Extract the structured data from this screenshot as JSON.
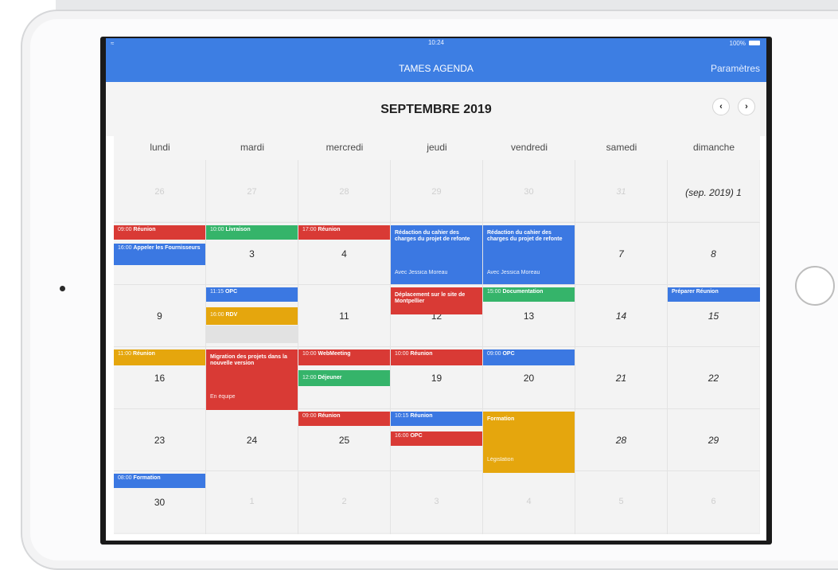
{
  "status": {
    "time": "10:24",
    "battery": "100%"
  },
  "header": {
    "title": "TAMES AGENDA",
    "settings": "Paramètres"
  },
  "calendar": {
    "month_title": "SEPTEMBRE 2019",
    "prev": "‹",
    "next": "›",
    "weekdays": [
      "lundi",
      "mardi",
      "mercredi",
      "jeudi",
      "vendredi",
      "samedi",
      "dimanche"
    ],
    "days": {
      "r0": [
        "26",
        "27",
        "28",
        "29",
        "30",
        "31",
        "(sep. 2019) 1"
      ],
      "r1": [
        "3",
        "4",
        "7",
        "8"
      ],
      "r2": [
        "9",
        "11",
        "12",
        "13",
        "14",
        "15"
      ],
      "r3": [
        "16",
        "19",
        "20",
        "21",
        "22"
      ],
      "r4": [
        "23",
        "24",
        "25",
        "28",
        "29"
      ],
      "r5": [
        "30",
        "1",
        "2",
        "3",
        "4",
        "5",
        "6"
      ]
    },
    "events": {
      "e1": {
        "time": "09:00",
        "title": "Réunion"
      },
      "e2": {
        "time": "16:00",
        "title": "Appeler les Fournisseurs"
      },
      "e3": {
        "time": "10:00",
        "title": "Livraison"
      },
      "e4": {
        "time": "17:00",
        "title": "Réunion"
      },
      "e5": {
        "title": "Rédaction du cahier des charges du projet de refonte",
        "sub": "Avec Jessica Moreau"
      },
      "e6": {
        "title": "Rédaction du cahier des charges du projet de refonte",
        "sub": "Avec Jessica Moreau"
      },
      "e7": {
        "time": "11:15",
        "title": "OPC"
      },
      "e8": {
        "time": "16:00",
        "title": "RDV"
      },
      "e9": {
        "title": "Déplacement sur le site de Montpellier"
      },
      "e10": {
        "time": "15:00",
        "title": "Documentation"
      },
      "e11": {
        "title": "Préparer Réunion"
      },
      "e12": {
        "time": "11:00",
        "title": "Réunion"
      },
      "e13": {
        "title": "Migration des projets dans la nouvelle version",
        "sub": "En équipe"
      },
      "e14": {
        "time": "10:00",
        "title": "WebMeeting"
      },
      "e15": {
        "time": "12:00",
        "title": "Déjeuner"
      },
      "e16": {
        "time": "10:00",
        "title": "Réunion"
      },
      "e17": {
        "time": "09:00",
        "title": "OPC"
      },
      "e18": {
        "time": "09:00",
        "title": "Réunion"
      },
      "e19": {
        "time": "10:15",
        "title": "Réunion"
      },
      "e20": {
        "time": "16:00",
        "title": "OPC"
      },
      "e21": {
        "title": "Formation",
        "sub": "Législation"
      },
      "e22": {
        "time": "08:00",
        "title": "Formation"
      }
    }
  },
  "colors": {
    "header": "#3d7ee3",
    "red": "#d93a35",
    "blue": "#3b78e2",
    "green": "#35b46a",
    "yellow": "#e5a60d"
  }
}
